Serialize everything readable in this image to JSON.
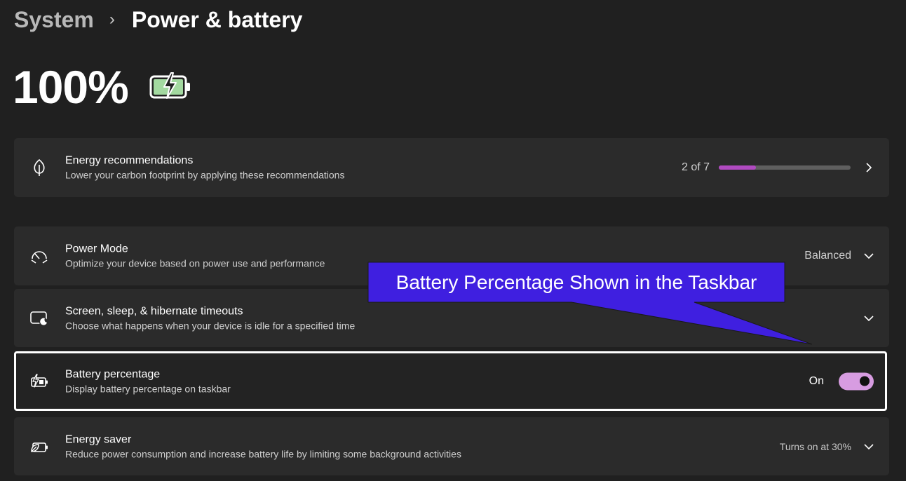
{
  "breadcrumb": {
    "root": "System",
    "separator": "›",
    "current": "Power & battery"
  },
  "battery": {
    "percent_text": "100%",
    "level": 1.0,
    "icon": "battery-charging-icon",
    "fill_color": "#a3d9a0"
  },
  "cards": {
    "energy_recommendations": {
      "title": "Energy recommendations",
      "subtitle": "Lower your carbon footprint by applying these recommendations",
      "icon": "leaf-icon",
      "count_text": "2 of 7",
      "progress": 0.28,
      "progress_color": "#b04ac0"
    },
    "power_mode": {
      "title": "Power Mode",
      "subtitle": "Optimize your device based on power use and performance",
      "icon": "speedometer-icon",
      "value": "Balanced"
    },
    "screen_sleep": {
      "title": "Screen, sleep, & hibernate timeouts",
      "subtitle": "Choose what happens when your device is idle for a specified time",
      "icon": "screen-sleep-icon"
    },
    "battery_percentage": {
      "title": "Battery percentage",
      "subtitle": "Display battery percentage on taskbar",
      "icon": "battery-charging-icon",
      "state_label": "On",
      "toggle_on": true,
      "toggle_color": "#d79ce1"
    },
    "energy_saver": {
      "title": "Energy saver",
      "subtitle": "Reduce power consumption and increase battery life by limiting some background activities",
      "icon": "energy-saver-icon",
      "value": "Turns on at 30%"
    }
  },
  "callout": {
    "text": "Battery Percentage Shown in the Taskbar",
    "color": "#3f1fe0"
  }
}
